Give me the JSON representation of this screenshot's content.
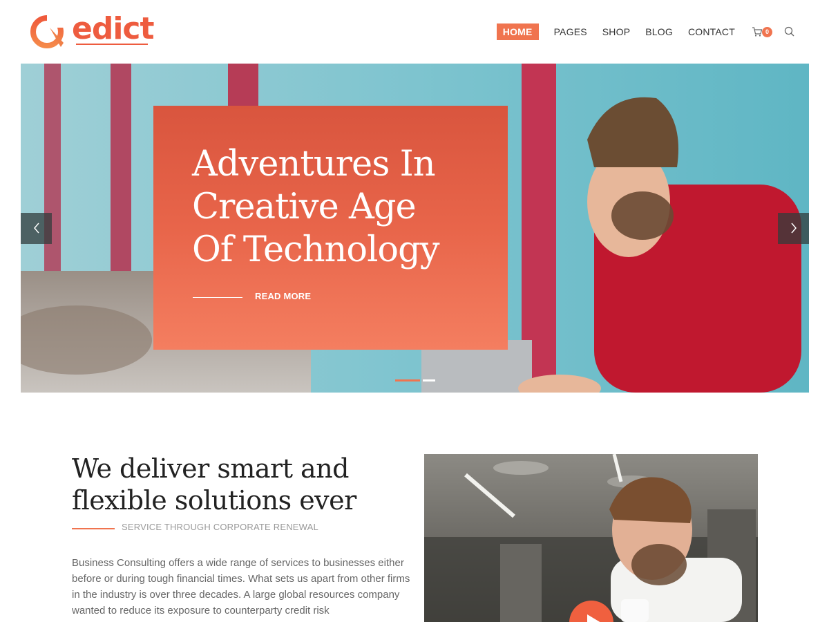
{
  "brand": {
    "name": "edict",
    "accent": "#f0744f",
    "logo_color": "#ee5c3f"
  },
  "nav": {
    "items": [
      "HOME",
      "PAGES",
      "SHOP",
      "BLOG",
      "CONTACT"
    ],
    "active": "HOME",
    "cart_count": "0",
    "cart_icon": "cart-icon",
    "search_icon": "search-icon"
  },
  "slider": {
    "title": "Adventures In Creative Age Of Technology",
    "title_lines": [
      "Adventures In",
      "Creative Age",
      "Of Technology"
    ],
    "cta": "READ MORE",
    "prev_icon": "chevron-left-icon",
    "next_icon": "chevron-right-icon",
    "slide_count": 2,
    "active_slide": 1
  },
  "intro": {
    "heading_lines": [
      "We deliver smart and",
      "flexible solutions ever"
    ],
    "subheading": "SERVICE THROUGH CORPORATE RENEWAL",
    "body": "Business Consulting offers a wide range of services to businesses either before or during tough financial times. What sets us apart from other firms in the industry is over three decades. A large global resources company wanted to reduce its exposure to counterparty credit risk",
    "play_icon": "play-icon"
  }
}
